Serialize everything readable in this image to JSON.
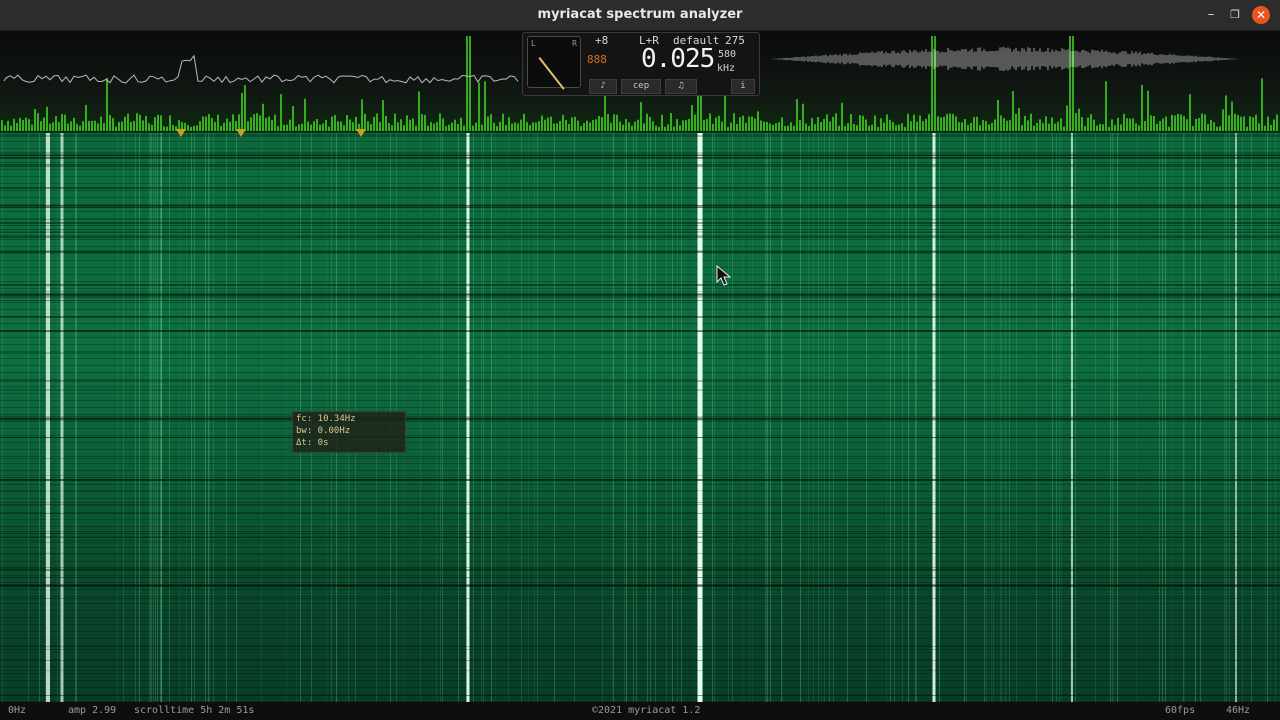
{
  "window": {
    "title": "myriacat spectrum analyzer",
    "controls": {
      "minimize": "–",
      "maximize": "❐",
      "close": "✕"
    },
    "close_color": "#e95420"
  },
  "panel": {
    "meter_left": "L",
    "meter_right": "R",
    "gain": "+8",
    "channel": "L+R",
    "preset": "default",
    "preset_num": "275",
    "digits_small": "888",
    "frequency": "0.025",
    "unit_top": "580",
    "unit_bottom": "kHz",
    "tabs": [
      "♪",
      "cep",
      "♫",
      "i"
    ]
  },
  "tooltip": {
    "fc": "fc: 10.34Hz",
    "bw": "bw: 0.00Hz",
    "dt": "Δt: 0s"
  },
  "statusbar": {
    "freq_min": "0Hz",
    "amp": "amp 2.99",
    "scrolltime": "scrolltime 5h 2m 51s",
    "copyright": "©2021 myriacat 1.2",
    "fps": "60fps",
    "freq_max": "46Hz"
  },
  "colors": {
    "spectrum_peak": "#4cff2a",
    "waterfall": "#0c6a3c",
    "marker": "#c8a020"
  },
  "icons": {
    "meter": "vu-meter-icon",
    "cursor": "mouse-pointer-icon"
  }
}
